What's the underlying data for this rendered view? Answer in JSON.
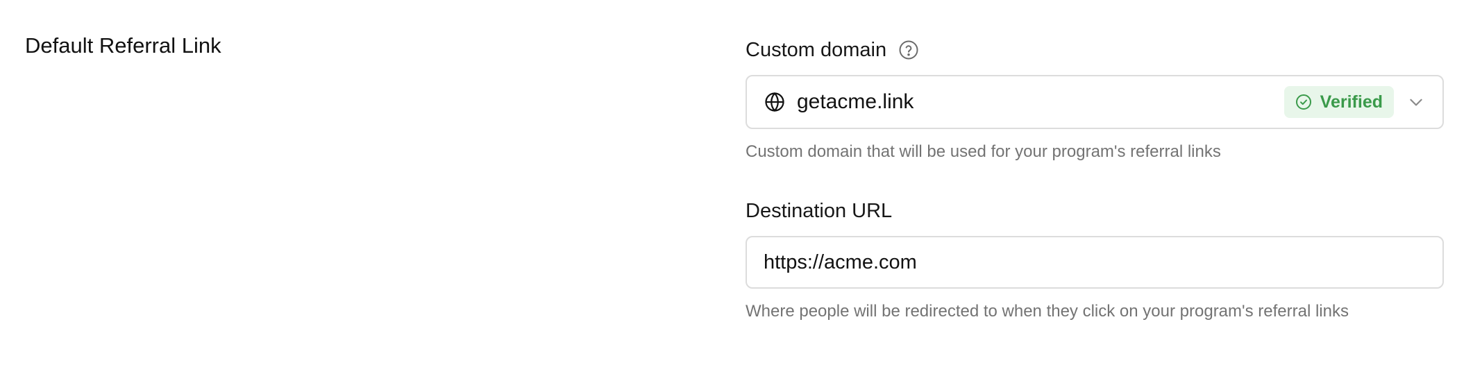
{
  "section": {
    "title": "Default Referral Link"
  },
  "custom_domain": {
    "label": "Custom domain",
    "help_icon": "question-circle-icon",
    "value": "getacme.link",
    "prefix_icon": "globe-icon",
    "badge": "Verified",
    "badge_icon": "check-circle-icon",
    "badge_color": "#3a9a4a",
    "badge_bg": "#e8f6ea",
    "help": "Custom domain that will be used for your program's referral links"
  },
  "destination_url": {
    "label": "Destination URL",
    "value": "https://acme.com",
    "help": "Where people will be redirected to when they click on your program's referral links"
  }
}
